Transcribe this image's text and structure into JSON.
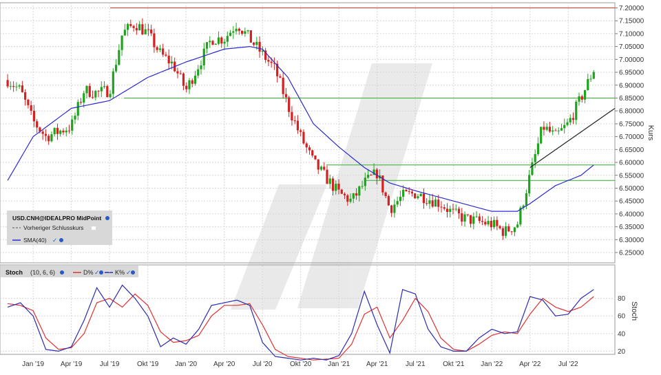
{
  "chart_data": [
    {
      "type": "candlestick",
      "panel": "price",
      "instrument": "USD.CNH@IDEALPRO MidPoint",
      "ylabel": "Kurs",
      "ylim": [
        6.21,
        7.22
      ],
      "y_ticks": [
        "7.20000",
        "7.15000",
        "7.10000",
        "7.05000",
        "7.00000",
        "6.95000",
        "6.90000",
        "6.85000",
        "6.80000",
        "6.75000",
        "6.70000",
        "6.65000",
        "6.60000",
        "6.55000",
        "6.50000",
        "6.45000",
        "6.40000",
        "6.35000",
        "6.30000",
        "6.25000"
      ],
      "x_ticks": [
        "Jan '19",
        "Apr '19",
        "Jul '19",
        "Okt '19",
        "Jan '20",
        "Apr '20",
        "Jul '20",
        "Okt '20",
        "Jan '21",
        "Apr '21",
        "Jul '21",
        "Okt '21",
        "Jan '22",
        "Apr '22",
        "Jul '22"
      ],
      "time_range": [
        "2018-11",
        "2022-09"
      ],
      "grid": true,
      "legend": {
        "placement": "bottom-left",
        "entries": [
          {
            "label": "USD.CNH@IDEALPRO MidPoint",
            "color": "#000000"
          },
          {
            "label": "Vorheriger Schlusskurs",
            "color": "#555555",
            "style": "dashed"
          },
          {
            "label": "SMA(40)",
            "color": "#2a2ad0"
          }
        ]
      },
      "close_series_approx": {
        "x": [
          "2018-11",
          "2018-12",
          "2019-01",
          "2019-02",
          "2019-03",
          "2019-04",
          "2019-05",
          "2019-06",
          "2019-07",
          "2019-08",
          "2019-09",
          "2019-10",
          "2019-11",
          "2019-12",
          "2020-01",
          "2020-02",
          "2020-03",
          "2020-04",
          "2020-05",
          "2020-06",
          "2020-07",
          "2020-08",
          "2020-09",
          "2020-10",
          "2020-11",
          "2020-12",
          "2021-01",
          "2021-02",
          "2021-03",
          "2021-04",
          "2021-05",
          "2021-06",
          "2021-07",
          "2021-08",
          "2021-09",
          "2021-10",
          "2021-11",
          "2021-12",
          "2022-01",
          "2022-02",
          "2022-03",
          "2022-04",
          "2022-05",
          "2022-06",
          "2022-07",
          "2022-08",
          "2022-09"
        ],
        "values": [
          6.92,
          6.88,
          6.76,
          6.7,
          6.72,
          6.74,
          6.88,
          6.87,
          6.88,
          7.1,
          7.14,
          7.1,
          7.02,
          6.98,
          6.88,
          6.98,
          7.08,
          7.08,
          7.14,
          7.08,
          7.02,
          6.96,
          6.82,
          6.7,
          6.6,
          6.54,
          6.48,
          6.45,
          6.52,
          6.56,
          6.42,
          6.47,
          6.48,
          6.46,
          6.44,
          6.4,
          6.38,
          6.37,
          6.36,
          6.33,
          6.36,
          6.55,
          6.74,
          6.7,
          6.75,
          6.85,
          6.96
        ]
      },
      "sma40_approx": {
        "x": [
          "2018-11",
          "2019-01",
          "2019-04",
          "2019-07",
          "2019-10",
          "2020-01",
          "2020-04",
          "2020-06",
          "2020-07",
          "2020-09",
          "2020-11",
          "2021-01",
          "2021-03",
          "2021-05",
          "2021-07",
          "2021-10",
          "2022-01",
          "2022-03",
          "2022-04",
          "2022-06",
          "2022-08",
          "2022-09"
        ],
        "values": [
          6.53,
          6.7,
          6.81,
          6.84,
          6.93,
          6.99,
          7.04,
          7.05,
          7.04,
          6.93,
          6.75,
          6.66,
          6.58,
          6.52,
          6.49,
          6.45,
          6.41,
          6.41,
          6.44,
          6.51,
          6.55,
          6.59
        ]
      },
      "horizontal_lines": [
        {
          "value": 7.2,
          "color": "#e03020"
        },
        {
          "value": 6.85,
          "color": "#2ab02a"
        },
        {
          "value": 6.59,
          "color": "#2ab02a",
          "from": "2020-12"
        },
        {
          "value": 6.53,
          "color": "#2ab02a",
          "from": "2021-03"
        }
      ],
      "trendline": {
        "from": [
          "2022-04",
          6.58
        ],
        "to": [
          "2022-09",
          6.81
        ],
        "color": "#222222"
      }
    },
    {
      "type": "line",
      "panel": "stochastic",
      "title": "Stoch",
      "params": "(10, 6, 6)",
      "ylabel": "Stoch",
      "ylim": [
        0,
        100
      ],
      "y_ticks": [
        "80",
        "60",
        "40",
        "20"
      ],
      "legend_entries": [
        {
          "label": "D%",
          "color": "#e03030"
        },
        {
          "label": "K%",
          "color": "#2a2ab0"
        }
      ],
      "series": [
        {
          "name": "K%",
          "x": [
            "2018-11",
            "2018-12",
            "2019-01",
            "2019-02",
            "2019-03",
            "2019-04",
            "2019-05",
            "2019-06",
            "2019-07",
            "2019-08",
            "2019-09",
            "2019-10",
            "2019-11",
            "2019-12",
            "2020-01",
            "2020-02",
            "2020-03",
            "2020-04",
            "2020-05",
            "2020-06",
            "2020-07",
            "2020-08",
            "2020-09",
            "2020-10",
            "2020-11",
            "2020-12",
            "2021-01",
            "2021-02",
            "2021-03",
            "2021-04",
            "2021-05",
            "2021-06",
            "2021-07",
            "2021-08",
            "2021-09",
            "2021-10",
            "2021-11",
            "2021-12",
            "2022-01",
            "2022-02",
            "2022-03",
            "2022-04",
            "2022-05",
            "2022-06",
            "2022-07",
            "2022-08",
            "2022-09"
          ],
          "values": [
            70,
            75,
            60,
            22,
            20,
            25,
            55,
            92,
            70,
            95,
            80,
            60,
            25,
            35,
            28,
            45,
            72,
            75,
            78,
            72,
            30,
            14,
            12,
            10,
            12,
            10,
            15,
            40,
            88,
            50,
            18,
            90,
            85,
            45,
            25,
            20,
            20,
            35,
            45,
            40,
            42,
            82,
            78,
            60,
            62,
            80,
            90
          ]
        },
        {
          "name": "D%",
          "x": [
            "2018-11",
            "2018-12",
            "2019-01",
            "2019-02",
            "2019-03",
            "2019-04",
            "2019-05",
            "2019-06",
            "2019-07",
            "2019-08",
            "2019-09",
            "2019-10",
            "2019-11",
            "2019-12",
            "2020-01",
            "2020-02",
            "2020-03",
            "2020-04",
            "2020-05",
            "2020-06",
            "2020-07",
            "2020-08",
            "2020-09",
            "2020-10",
            "2020-11",
            "2020-12",
            "2021-01",
            "2021-02",
            "2021-03",
            "2021-04",
            "2021-05",
            "2021-06",
            "2021-07",
            "2021-08",
            "2021-09",
            "2021-10",
            "2021-11",
            "2021-12",
            "2022-01",
            "2022-02",
            "2022-03",
            "2022-04",
            "2022-05",
            "2022-06",
            "2022-07",
            "2022-08",
            "2022-09"
          ],
          "values": [
            74,
            72,
            66,
            35,
            22,
            24,
            40,
            75,
            80,
            70,
            85,
            72,
            42,
            30,
            32,
            38,
            60,
            72,
            72,
            74,
            50,
            22,
            14,
            12,
            10,
            11,
            12,
            28,
            62,
            70,
            35,
            55,
            80,
            65,
            35,
            22,
            20,
            28,
            38,
            42,
            40,
            62,
            80,
            70,
            65,
            70,
            82
          ]
        }
      ]
    }
  ]
}
